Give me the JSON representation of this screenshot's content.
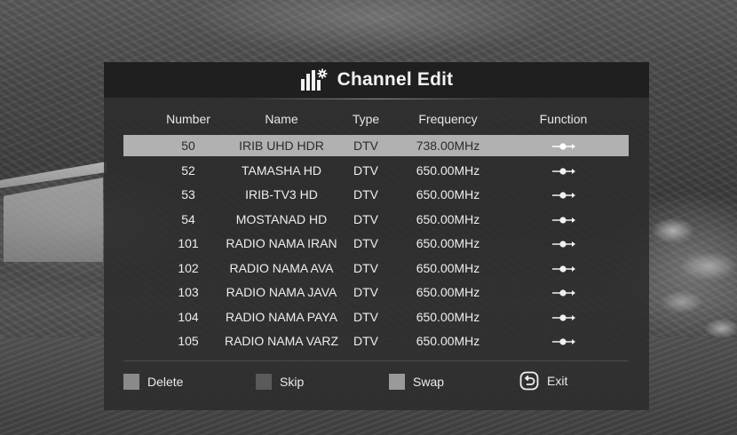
{
  "dialog": {
    "title": "Channel Edit",
    "title_icon": "channel-bars-gear-icon"
  },
  "columns": {
    "number": "Number",
    "name": "Name",
    "type": "Type",
    "frequency": "Frequency",
    "function": "Function"
  },
  "channels": [
    {
      "number": "50",
      "name": "IRIB UHD HDR",
      "type": "DTV",
      "frequency": "738.00MHz",
      "function_icon": "move-arrow-icon",
      "selected": true
    },
    {
      "number": "52",
      "name": "TAMASHA HD",
      "type": "DTV",
      "frequency": "650.00MHz",
      "function_icon": "move-arrow-icon"
    },
    {
      "number": "53",
      "name": "IRIB-TV3 HD",
      "type": "DTV",
      "frequency": "650.00MHz",
      "function_icon": "move-arrow-icon"
    },
    {
      "number": "54",
      "name": "MOSTANAD HD",
      "type": "DTV",
      "frequency": "650.00MHz",
      "function_icon": "move-arrow-icon"
    },
    {
      "number": "101",
      "name": "RADIO NAMA IRAN",
      "type": "DTV",
      "frequency": "650.00MHz",
      "function_icon": "move-arrow-icon"
    },
    {
      "number": "102",
      "name": "RADIO NAMA AVA",
      "type": "DTV",
      "frequency": "650.00MHz",
      "function_icon": "move-arrow-icon"
    },
    {
      "number": "103",
      "name": "RADIO NAMA JAVA",
      "type": "DTV",
      "frequency": "650.00MHz",
      "function_icon": "move-arrow-icon"
    },
    {
      "number": "104",
      "name": "RADIO NAMA PAYA",
      "type": "DTV",
      "frequency": "650.00MHz",
      "function_icon": "move-arrow-icon"
    },
    {
      "number": "105",
      "name": "RADIO NAMA VARZ",
      "type": "DTV",
      "frequency": "650.00MHz",
      "function_icon": "move-arrow-icon"
    }
  ],
  "footer": {
    "delete_label": "Delete",
    "delete_color": "#8a8a8a",
    "skip_label": "Skip",
    "skip_color": "#5a5a5a",
    "swap_label": "Swap",
    "swap_color": "#9a9a9a",
    "exit_label": "Exit",
    "exit_icon": "return-arrow-icon"
  },
  "colors": {
    "panel_bg": "#2c2c2c",
    "selected_row": "#b1b1b1"
  }
}
